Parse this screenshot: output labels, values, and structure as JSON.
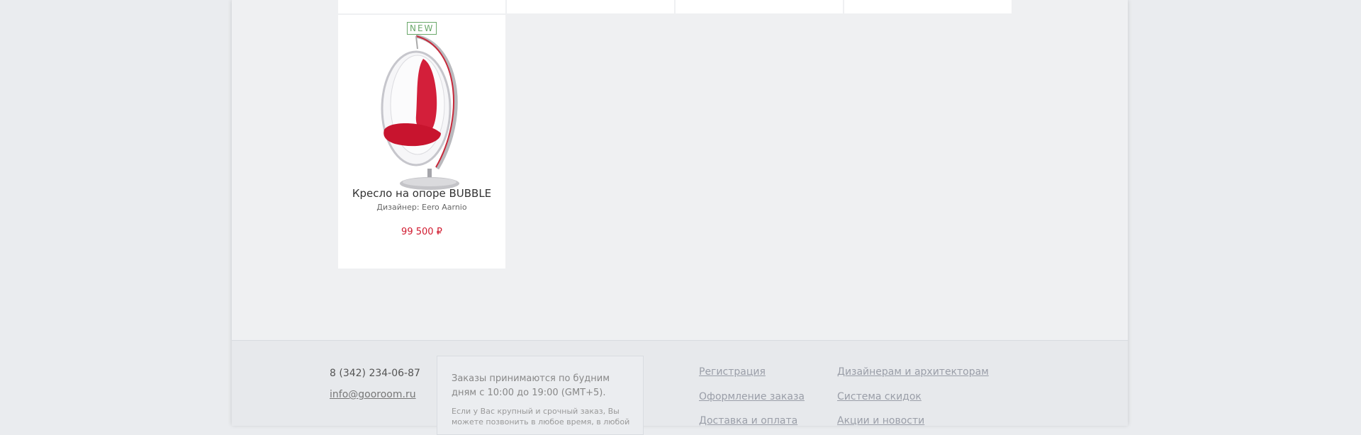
{
  "product": {
    "badge": "NEW",
    "title": "Кресло на опоре BUBBLE",
    "designer": "Дизайнер: Eero Aarnio",
    "price": "99 500 ₽"
  },
  "footer": {
    "phone": "8 (342) 234-06-87",
    "email": "info@gooroom.ru",
    "info_main": "Заказы принимаются по будним дням с 10:00 до 19:00 (GMT+5).",
    "info_extra": "Если у Вас крупный и срочный заказ, Вы можете позвонить в любое время, в любой",
    "links_col1": [
      "Регистрация",
      "Оформление заказа",
      "Доставка и оплата"
    ],
    "links_col2": [
      "Дизайнерам и архитекторам",
      "Система скидок",
      "Акции и новости"
    ]
  },
  "colors": {
    "price": "#d0192e",
    "badge": "#6aa86a"
  }
}
